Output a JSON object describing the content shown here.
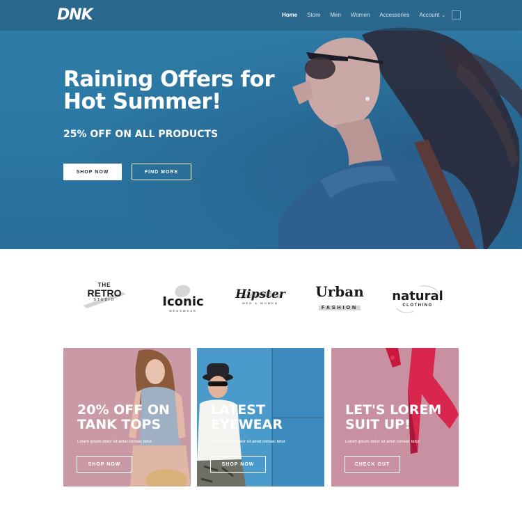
{
  "colors": {
    "hero_bg": "#2c7aa6",
    "card1_bg": "#c99aa6",
    "card2_bg": "#3e8cbf",
    "card3_bg": "#c890a0",
    "brand_text": "#1a1a1a"
  },
  "header": {
    "logo": "DNK",
    "nav": [
      {
        "label": "Home"
      },
      {
        "label": "Store"
      },
      {
        "label": "Men"
      },
      {
        "label": "Women"
      },
      {
        "label": "Accessories"
      },
      {
        "label": "Account"
      }
    ],
    "account_caret_icon": "chevron-down-icon",
    "cart_icon": "cart-icon"
  },
  "hero": {
    "title": "Raining Offers for Hot Summer!",
    "subtitle": "25% OFF ON ALL PRODUCTS",
    "primary_button": "SHOP NOW",
    "secondary_button": "FIND MORE"
  },
  "brands": [
    {
      "top": "THE",
      "main": "RETRO",
      "sub": "STUDIO"
    },
    {
      "main": "Iconic",
      "sub": "MENSWEAR"
    },
    {
      "main": "Hipster",
      "sub": "MEN & WOMEN"
    },
    {
      "main": "Urban",
      "sub": "FASHION"
    },
    {
      "main": "natural",
      "sub": "CLOTHING"
    }
  ],
  "cards": [
    {
      "title_line1": "20% OFF ON",
      "title_line2": "TANK TOPS",
      "text": "Lorem ipsum dolor sit amet consec tetur.",
      "button": "SHOP NOW"
    },
    {
      "title_line1": "LATEST",
      "title_line2": "EYEWEAR",
      "text": "Lorem ipsum dolor sit amet consec tetur.",
      "button": "SHOP NOW"
    },
    {
      "title_line1": "LET'S LOREM",
      "title_line2": "SUIT UP!",
      "text": "Lorem ipsum dolor sit amet consec tetur.",
      "button": "CHECK OUT"
    }
  ]
}
